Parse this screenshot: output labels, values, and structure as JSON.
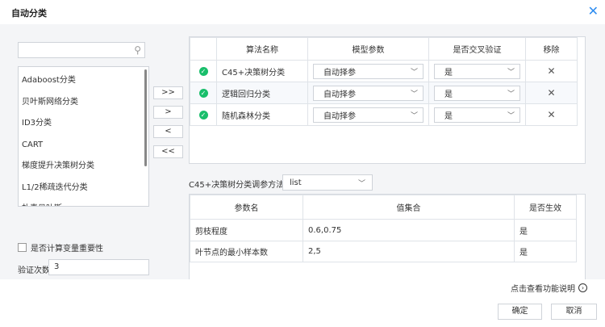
{
  "dialog": {
    "title": "自动分类",
    "close_icon": "close-icon"
  },
  "left": {
    "search": {
      "value": "",
      "placeholder": ""
    },
    "algorithms": [
      "Adaboost分类",
      "贝叶斯网络分类",
      "ID3分类",
      "CART",
      "梯度提升决策树分类",
      "L1/2稀疏迭代分类",
      "朴素贝叶斯"
    ],
    "importance_label": "是否计算变量重要性",
    "importance_checked": false,
    "cv_count_label": "验证次数",
    "cv_count_value": "3"
  },
  "move_buttons": {
    "add_all": ">>",
    "add": ">",
    "remove": "<",
    "remove_all": "<<"
  },
  "selected_table": {
    "headers": [
      "",
      "算法名称",
      "模型参数",
      "是否交叉验证",
      "移除"
    ],
    "rows": [
      {
        "name": "C45+决策树分类",
        "param": "自动择参",
        "cv": "是"
      },
      {
        "name": "逻辑回归分类",
        "param": "自动择参",
        "cv": "是"
      },
      {
        "name": "随机森林分类",
        "param": "自动择参",
        "cv": "是"
      }
    ]
  },
  "tuning": {
    "label": "C45+决策树分类调参方法",
    "method": "list"
  },
  "param_table": {
    "headers": [
      "参数名",
      "值集合",
      "是否生效"
    ],
    "rows": [
      {
        "name": "剪枝程度",
        "values": "0.6,0.75",
        "active": "是"
      },
      {
        "name": "叶节点的最小样本数",
        "values": "2,5",
        "active": "是"
      }
    ]
  },
  "help_link": "点击查看功能说明",
  "footer": {
    "ok": "确定",
    "cancel": "取消"
  },
  "colors": {
    "accent": "#2d8cf0",
    "success": "#19be6b",
    "panel": "#f4f5f7"
  }
}
